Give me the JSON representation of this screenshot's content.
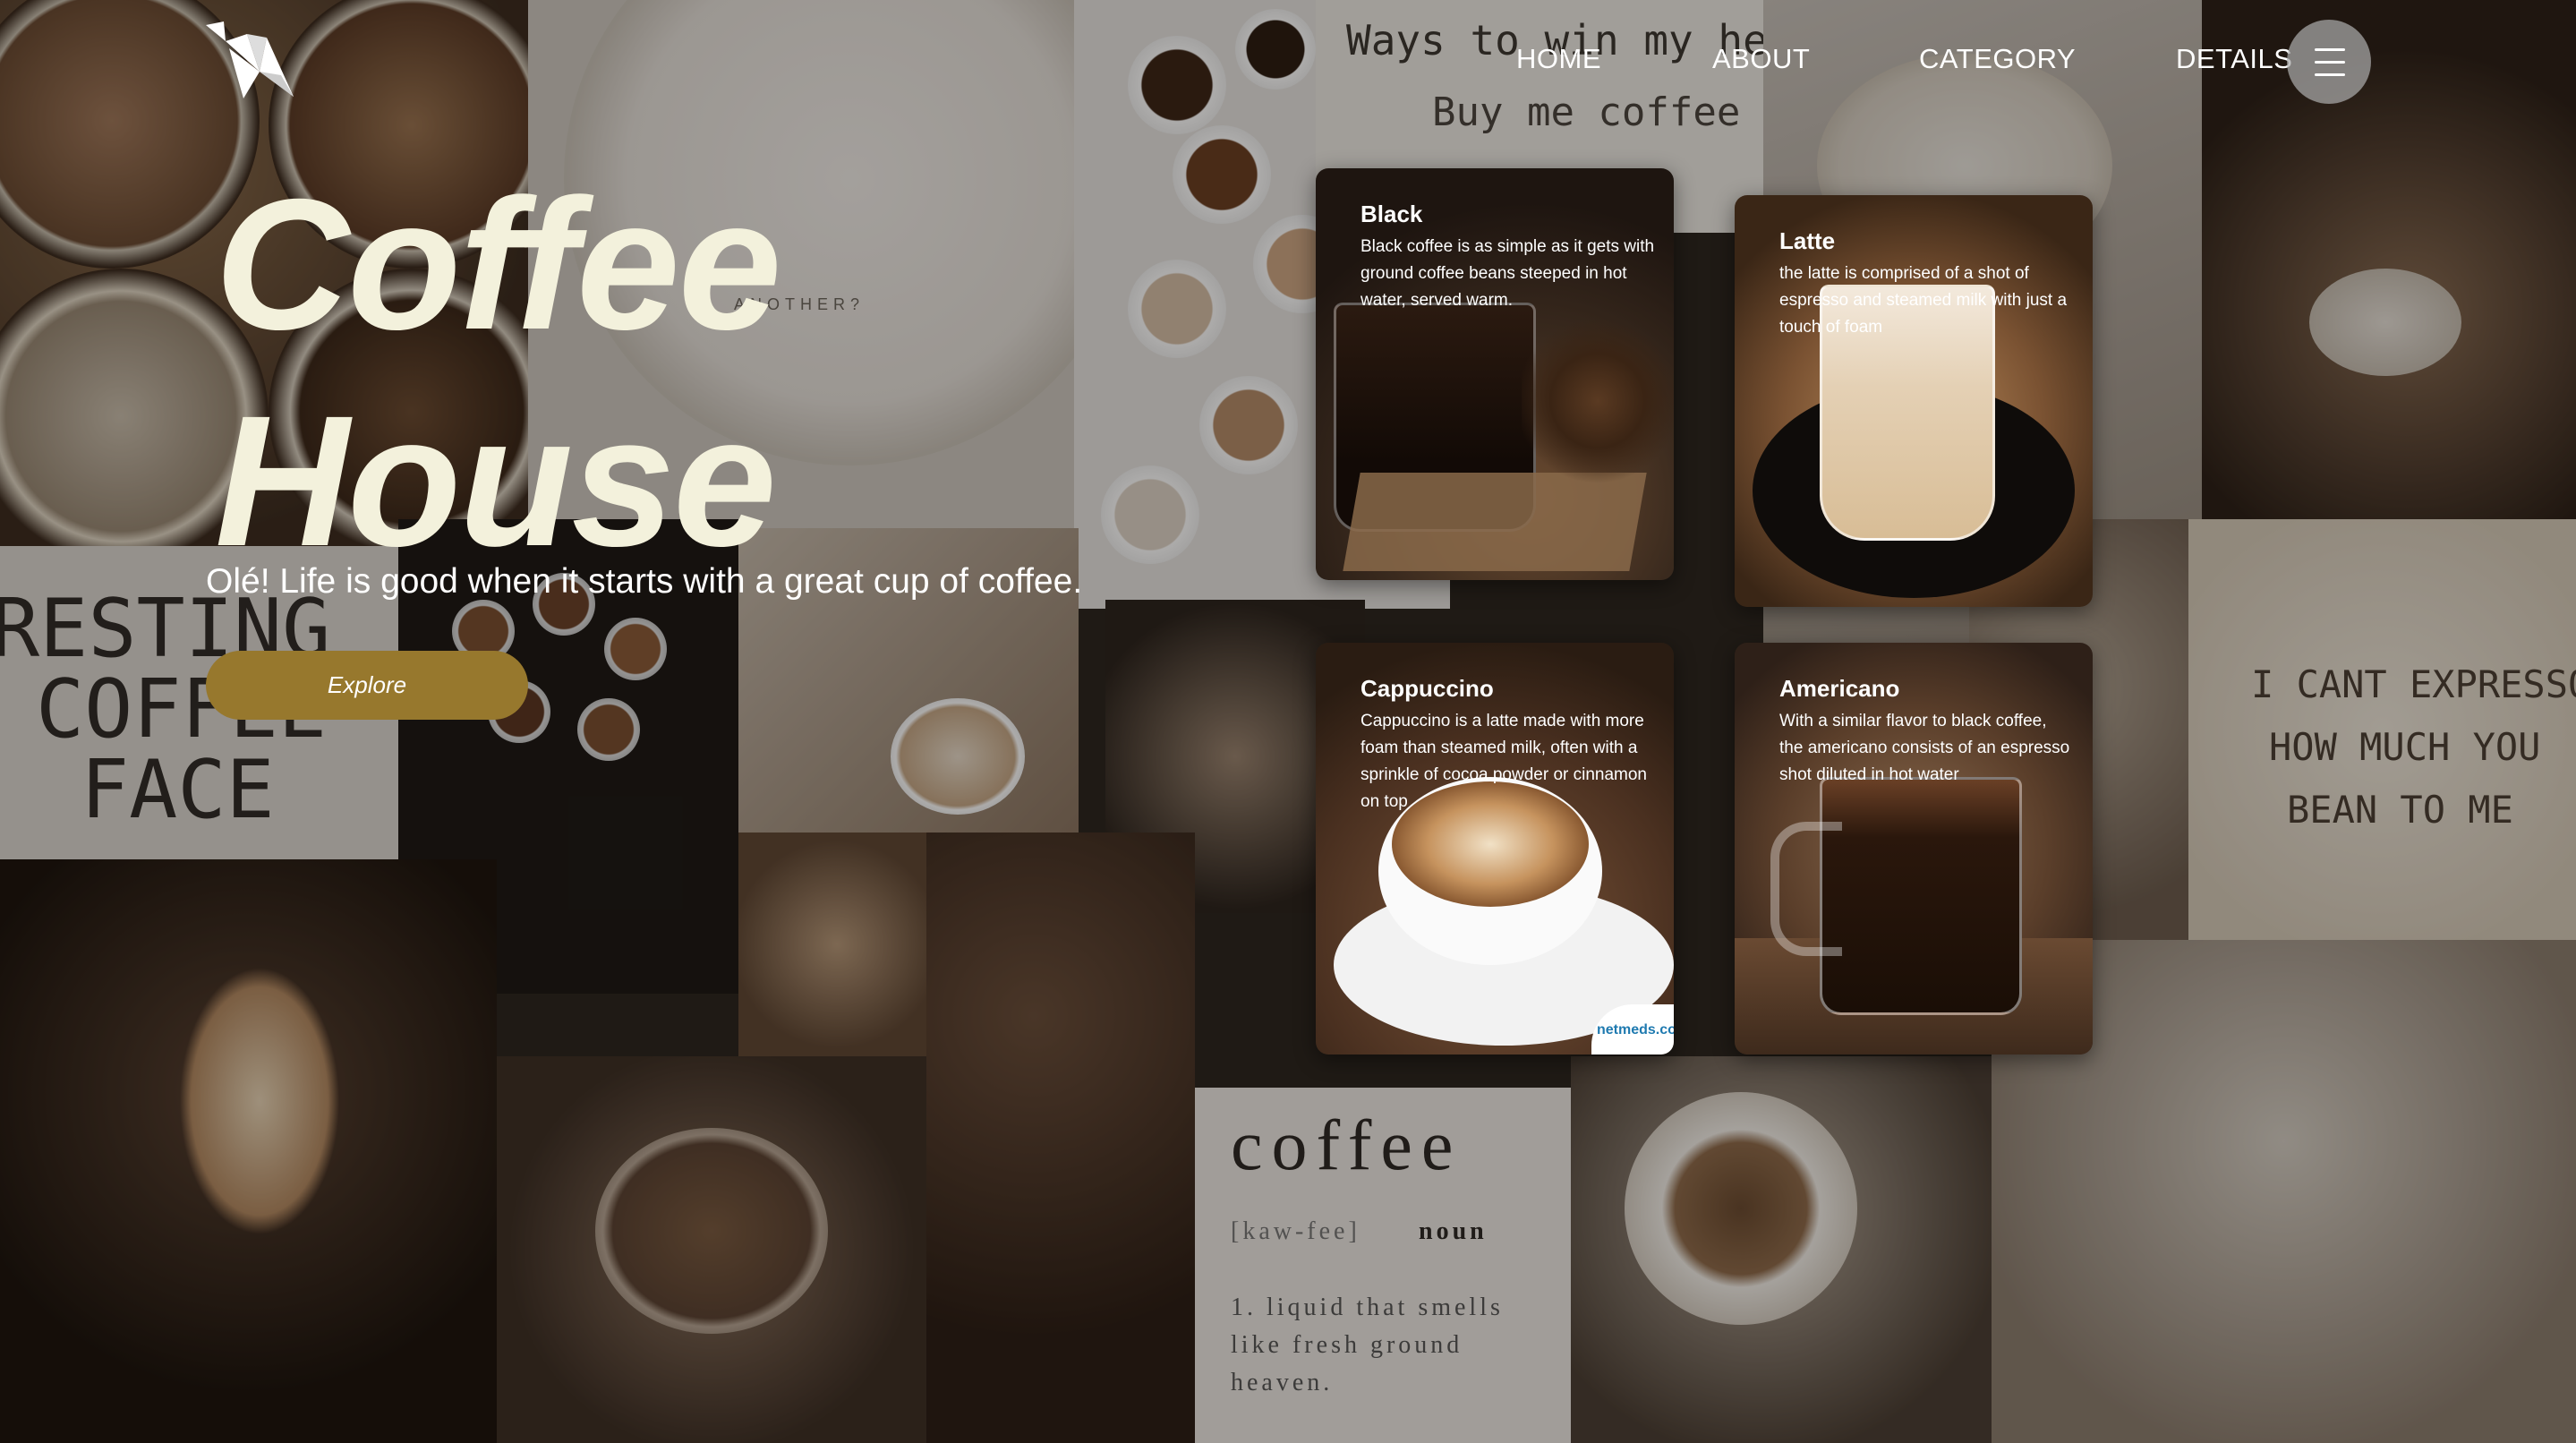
{
  "brand": {
    "logo_icon": "origami-bird-icon"
  },
  "nav": {
    "links": [
      {
        "label": "HOME"
      },
      {
        "label": "ABOUT"
      },
      {
        "label": "CATEGORY"
      },
      {
        "label": "DETAILS"
      }
    ],
    "menu_icon": "hamburger-menu-icon"
  },
  "hero": {
    "title_line1": "Coffee",
    "title_line2": "House",
    "tagline": "Olé! Life is good when it starts with a great cup of coffee.",
    "cta_label": "Explore"
  },
  "cards": [
    {
      "title": "Black",
      "description": "Black coffee is as simple as it gets with ground coffee beans steeped in hot water, served warm."
    },
    {
      "title": "Latte",
      "description": "the latte is comprised of a shot of espresso and steamed milk with just a touch of foam"
    },
    {
      "title": "Cappuccino",
      "description": "Cappuccino is a latte made with more foam than steamed milk, often with a sprinkle of cocoa powder or cinnamon on top",
      "watermark": "netmeds.com"
    },
    {
      "title": "Americano",
      "description": "With a similar flavor to black coffee, the americano consists of an espresso shot diluted in hot water"
    }
  ],
  "background": {
    "quote_top": "Ways to win my heart:",
    "quote_top_2": "Buy me coffee",
    "cup_text": "ANOTHER?",
    "resting_face": [
      "RESTING",
      "COFFEE",
      "FACE"
    ],
    "espresso_pun": [
      "I CANT EXPRESSO",
      "HOW MUCH YOU",
      "BEAN TO ME"
    ],
    "dictionary_word": "coffee",
    "dictionary_pron": "[kaw-fee]",
    "dictionary_pos": "noun",
    "dictionary_def": [
      "1. liquid that smells",
      "like fresh ground",
      "heaven."
    ]
  },
  "colors": {
    "accent": "#97782d",
    "title": "#f3f1dc",
    "menu_button": "#aaaaaa"
  }
}
